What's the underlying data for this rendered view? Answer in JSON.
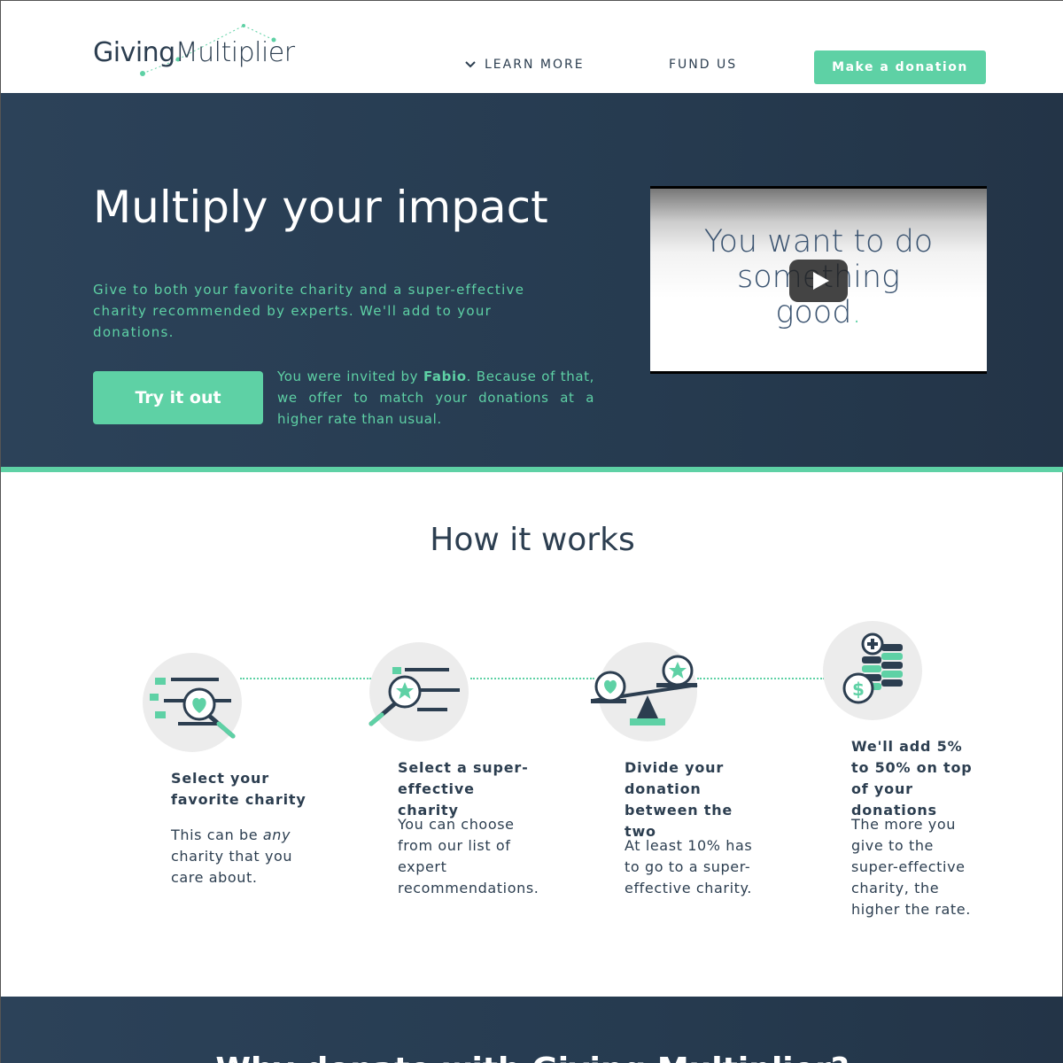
{
  "header": {
    "logo_part1": "Giving",
    "logo_part2": "Multiplier",
    "nav_learn_more": "LEARN MORE",
    "nav_fund_us": "FUND US",
    "donate_button": "Make a donation"
  },
  "hero": {
    "title": "Multiply your impact",
    "description": "Give to both your favorite charity and a super-effective charity recommended by experts. We'll add to your donations.",
    "try_button": "Try it out",
    "invite_prefix": "You were invited by ",
    "invite_name": "Fabio",
    "invite_suffix": ". Because of that, we offer to match your donations at a higher rate than usual.",
    "video_line1": "You want to do",
    "video_line2": "something",
    "video_line3": "good",
    "video_dot": "."
  },
  "how_it_works": {
    "title": "How it works",
    "steps": [
      {
        "title": "Select your favorite charity",
        "desc_before": "This can be ",
        "desc_em": "any",
        "desc_after": " charity that you care about."
      },
      {
        "title": "Select a super-effective charity",
        "desc": "You can choose from our list of expert recommendations."
      },
      {
        "title": "Divide your donation between the two",
        "desc": "At least 10% has to go to a super-effective charity."
      },
      {
        "title": "We'll add 5% to 50% on top of your donations",
        "desc": "The more you give to the super-effective charity, the higher the rate."
      }
    ]
  },
  "bottom": {
    "title": "Why donate with Giving Multiplier?"
  },
  "colors": {
    "accent": "#5ed1a5",
    "navy": "#2c3e50",
    "hero_bg": "#263b50"
  }
}
